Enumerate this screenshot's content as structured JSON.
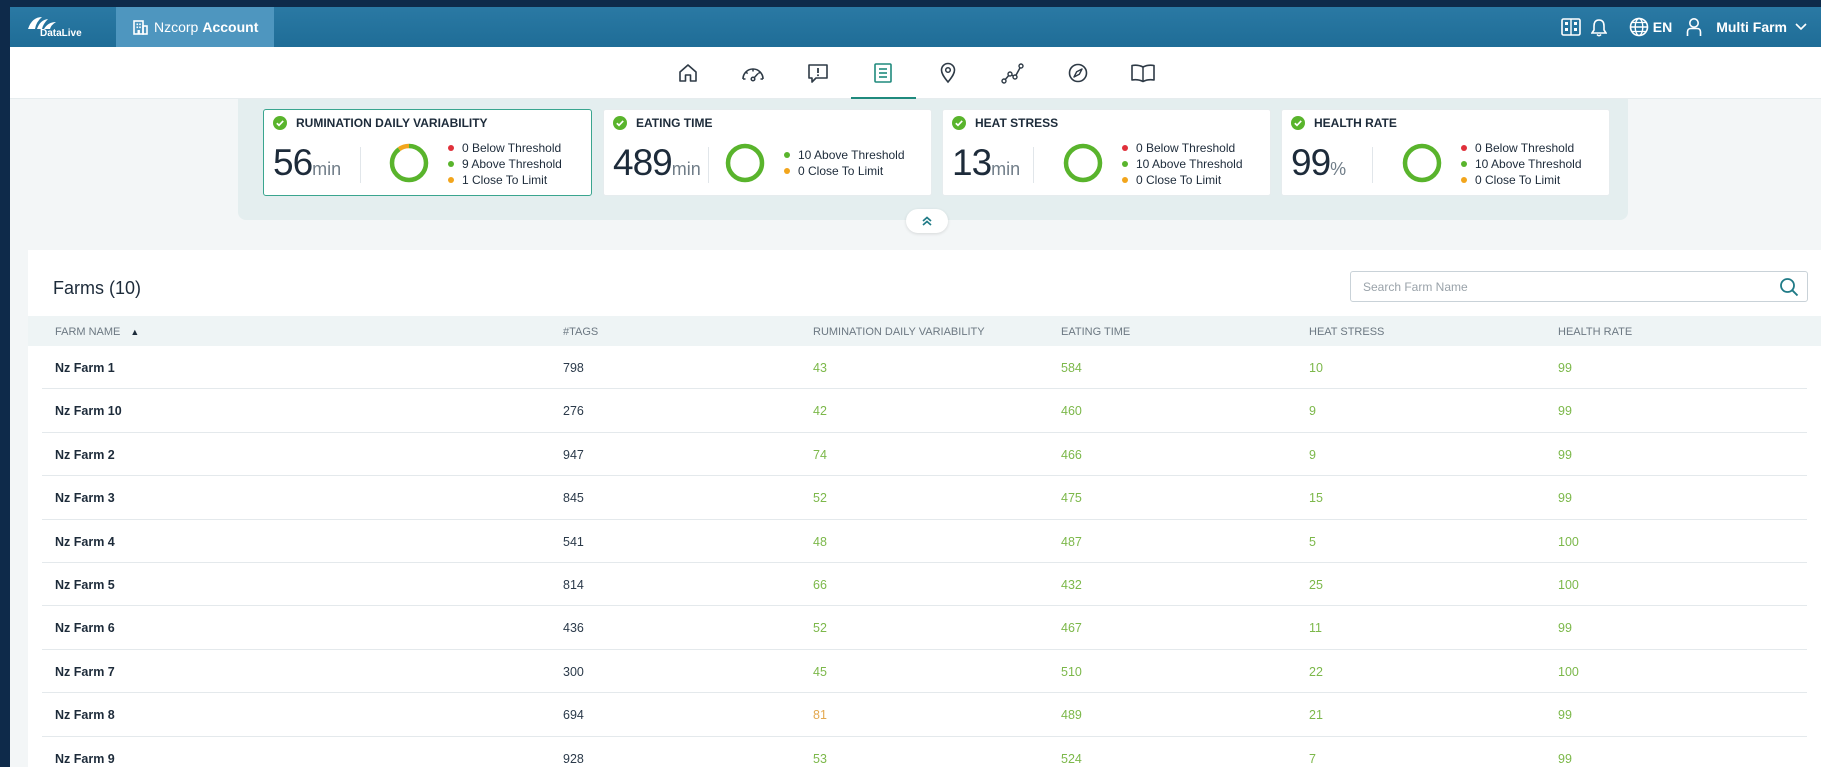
{
  "brand": {
    "logo_text": "DataLive"
  },
  "account": {
    "prefix": "Nzcorp",
    "bold": "Account"
  },
  "topright": {
    "lang": "EN",
    "user": "Multi Farm"
  },
  "nav": [
    {
      "icon": "home-icon",
      "active": false
    },
    {
      "icon": "gauge-icon",
      "active": false
    },
    {
      "icon": "alert-icon",
      "active": false
    },
    {
      "icon": "report-list-icon",
      "active": true
    },
    {
      "icon": "location-pin-icon",
      "active": false
    },
    {
      "icon": "trend-chart-icon",
      "active": false
    },
    {
      "icon": "compass-icon",
      "active": false
    },
    {
      "icon": "book-icon",
      "active": false
    }
  ],
  "colors": {
    "ok": "#7cb84a",
    "warn": "#e3a84f",
    "danger": "#e0303a",
    "accent": "#1f8a7d"
  },
  "kpis": [
    {
      "title": "RUMINATION DAILY VARIABILITY",
      "value": "56",
      "unit": "min",
      "selected": true,
      "legend": [
        {
          "color": "#e0303a",
          "text": "0 Below Threshold"
        },
        {
          "color": "#59b42c",
          "text": "9 Above Threshold"
        },
        {
          "color": "#f2a51c",
          "text": "1 Close To Limit"
        }
      ],
      "ring": {
        "green": 0.9,
        "orange": 0.1
      }
    },
    {
      "title": "EATING TIME",
      "value": "489",
      "unit": "min",
      "selected": false,
      "legend": [
        {
          "color": "#59b42c",
          "text": "10 Above Threshold"
        },
        {
          "color": "#f2a51c",
          "text": "0 Close To Limit"
        }
      ],
      "ring": {
        "green": 1,
        "orange": 0
      }
    },
    {
      "title": "HEAT STRESS",
      "value": "13",
      "unit": "min",
      "selected": false,
      "legend": [
        {
          "color": "#e0303a",
          "text": "0 Below Threshold"
        },
        {
          "color": "#59b42c",
          "text": "10 Above Threshold"
        },
        {
          "color": "#f2a51c",
          "text": "0 Close To Limit"
        }
      ],
      "ring": {
        "green": 1,
        "orange": 0
      }
    },
    {
      "title": "HEALTH RATE",
      "value": "99",
      "unit": "%",
      "selected": false,
      "legend": [
        {
          "color": "#e0303a",
          "text": "0 Below Threshold"
        },
        {
          "color": "#59b42c",
          "text": "10 Above Threshold"
        },
        {
          "color": "#f2a51c",
          "text": "0 Close To Limit"
        }
      ],
      "ring": {
        "green": 1,
        "orange": 0
      }
    }
  ],
  "table": {
    "title": "Farms (10)",
    "search_placeholder": "Search Farm Name",
    "columns": [
      "FARM NAME",
      "#TAGS",
      "RUMINATION DAILY VARIABILITY",
      "EATING TIME",
      "HEAT STRESS",
      "HEALTH RATE"
    ],
    "rows": [
      {
        "name": "Nz Farm 1",
        "tags": "798",
        "rumination": "43",
        "eating": "584",
        "heat": "10",
        "health": "99",
        "rumination_status": "ok"
      },
      {
        "name": "Nz Farm 10",
        "tags": "276",
        "rumination": "42",
        "eating": "460",
        "heat": "9",
        "health": "99",
        "rumination_status": "ok"
      },
      {
        "name": "Nz Farm 2",
        "tags": "947",
        "rumination": "74",
        "eating": "466",
        "heat": "9",
        "health": "99",
        "rumination_status": "ok"
      },
      {
        "name": "Nz Farm 3",
        "tags": "845",
        "rumination": "52",
        "eating": "475",
        "heat": "15",
        "health": "99",
        "rumination_status": "ok"
      },
      {
        "name": "Nz Farm 4",
        "tags": "541",
        "rumination": "48",
        "eating": "487",
        "heat": "5",
        "health": "100",
        "rumination_status": "ok"
      },
      {
        "name": "Nz Farm 5",
        "tags": "814",
        "rumination": "66",
        "eating": "432",
        "heat": "25",
        "health": "100",
        "rumination_status": "ok"
      },
      {
        "name": "Nz Farm 6",
        "tags": "436",
        "rumination": "52",
        "eating": "467",
        "heat": "11",
        "health": "99",
        "rumination_status": "ok"
      },
      {
        "name": "Nz Farm 7",
        "tags": "300",
        "rumination": "45",
        "eating": "510",
        "heat": "22",
        "health": "100",
        "rumination_status": "ok"
      },
      {
        "name": "Nz Farm 8",
        "tags": "694",
        "rumination": "81",
        "eating": "489",
        "heat": "21",
        "health": "99",
        "rumination_status": "warn"
      },
      {
        "name": "Nz Farm 9",
        "tags": "928",
        "rumination": "53",
        "eating": "524",
        "heat": "7",
        "health": "99",
        "rumination_status": "ok"
      }
    ]
  }
}
